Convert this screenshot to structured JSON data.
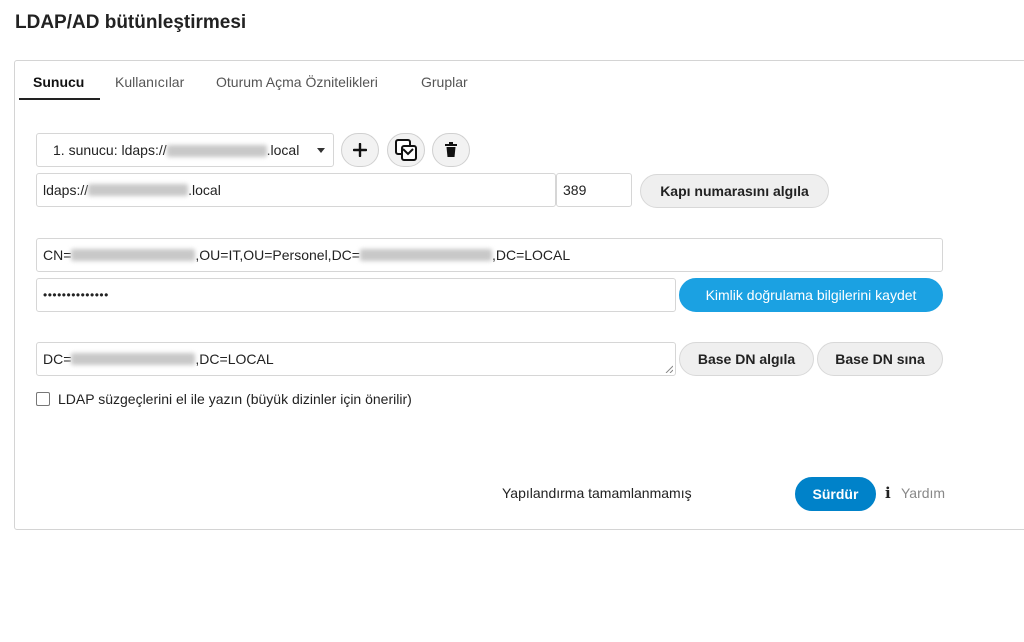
{
  "page": {
    "title": "LDAP/AD bütünleştirmesi"
  },
  "tabs": [
    {
      "label": "Sunucu"
    },
    {
      "label": "Kullanıcılar"
    },
    {
      "label": "Oturum Açma Öznitelikleri"
    },
    {
      "label": "Gruplar"
    }
  ],
  "server": {
    "select_prefix": "1. sunucu: ldaps://",
    "select_suffix": ".local",
    "host_prefix": "ldaps://",
    "host_suffix": ".local",
    "port": "389",
    "detect_port_label": "Kapı numarasını algıla"
  },
  "credentials": {
    "user_dn_prefix": "CN=",
    "user_dn_middle": ",OU=IT,OU=Personel,DC=",
    "user_dn_suffix": ",DC=LOCAL",
    "password_mask": "••••••••••••••",
    "save_label": "Kimlik doğrulama bilgilerini kaydet"
  },
  "base_dn": {
    "prefix": "DC=",
    "suffix": ",DC=LOCAL",
    "detect_label": "Base DN algıla",
    "test_label": "Base DN sına"
  },
  "manual_filter_label": "LDAP süzgeçlerini el ile yazın (büyük dizinler için önerilir)",
  "footer": {
    "status": "Yapılandırma tamamlanmamış",
    "continue_label": "Sürdür",
    "help_icon_glyph": "i",
    "help_label": "Yardım"
  },
  "colors": {
    "accent": "#1ba1e2",
    "primary_dark": "#0082c9"
  }
}
